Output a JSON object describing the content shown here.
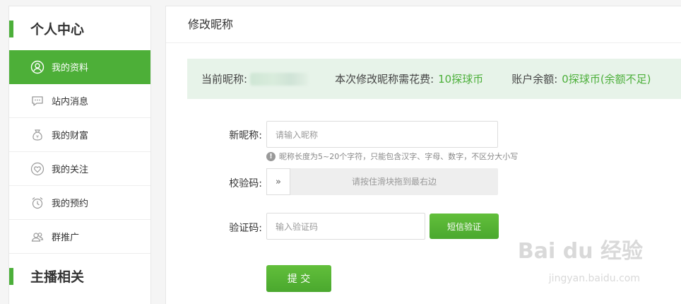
{
  "sidebar": {
    "section1_title": "个人中心",
    "items": [
      {
        "label": "我的资料",
        "icon": "user-icon",
        "active": true
      },
      {
        "label": "站内消息",
        "icon": "message-icon"
      },
      {
        "label": "我的财富",
        "icon": "money-bag-icon"
      },
      {
        "label": "我的关注",
        "icon": "heart-icon"
      },
      {
        "label": "我的预约",
        "icon": "alarm-clock-icon"
      },
      {
        "label": "群推广",
        "icon": "group-icon"
      }
    ],
    "section2_title": "主播相关"
  },
  "main": {
    "title": "修改昵称",
    "info": {
      "current_label": "当前昵称:",
      "cost_label": "本次修改昵称需花费:",
      "cost_value": "10探球币",
      "balance_label": "账户余额:",
      "balance_value": "0探球币(余额不足)"
    },
    "form": {
      "nickname_label": "新昵称:",
      "nickname_placeholder": "请输入昵称",
      "hint": "昵称长度为5~20个字符，只能包含汉字、字母、数字，不区分大小写",
      "captcha_label": "校验码:",
      "slider_handle": "»",
      "slider_text": "请按住滑块拖到最右边",
      "sms_label": "验证码:",
      "sms_placeholder": "输入验证码",
      "sms_button": "短信验证",
      "submit_button": "提 交"
    }
  },
  "watermark": {
    "brand": "Bai du 经验",
    "url": "jingyan.baidu.com"
  },
  "colors": {
    "accent": "#4caf3a",
    "info_bg": "#e7f3e9"
  }
}
